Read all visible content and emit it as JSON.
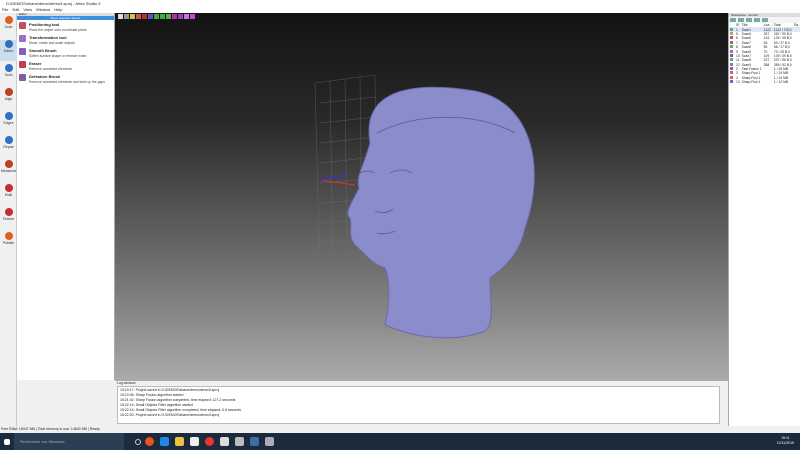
{
  "window": {
    "title": "D:\\DEMOS\\shane\\demo\\demo3.sproj - Artec Studio 9"
  },
  "menu": [
    "File",
    "Edit",
    "View",
    "Window",
    "Help"
  ],
  "left_toolbar": [
    {
      "label": "Scan",
      "color": "#e06020"
    },
    {
      "label": "Editor",
      "color": "#3070c0",
      "active": true
    },
    {
      "label": "Tools",
      "color": "#3070c0"
    },
    {
      "label": "Align",
      "color": "#c04020"
    },
    {
      "label": "Edges",
      "color": "#3070c0"
    },
    {
      "label": "Repair",
      "color": "#3070c0"
    },
    {
      "label": "Measures",
      "color": "#c04020"
    },
    {
      "label": "Multi",
      "color": "#c03030"
    },
    {
      "label": "Texture",
      "color": "#c03030"
    },
    {
      "label": "Publish",
      "color": "#e06020"
    }
  ],
  "tool_panel": {
    "header": "Editor",
    "banner": "Move selected objects",
    "tools": [
      {
        "title": "Positioning tool",
        "desc": "Place the object onto coordinate plane",
        "color": "#c05060"
      },
      {
        "title": "Transformation tool",
        "desc": "Move, rotate and scale objects",
        "color": "#a070c0"
      },
      {
        "title": "Smooth Brush",
        "desc": "Soften surface shape or remove noise",
        "color": "#8060c0"
      },
      {
        "title": "Eraser",
        "desc": "Remove unwanted elements",
        "color": "#c04050"
      },
      {
        "title": "Defeature Brush",
        "desc": "Remove unwanted elements and stick up the gaps",
        "color": "#8060a0"
      }
    ]
  },
  "log": {
    "header": "Log window",
    "lines": [
      "15:19:17: Project saved in D:\\DEMOS\\shane\\demo\\demo3.sproj",
      "15:19:35: Sharp Fusion algorithm started",
      "15:21:42: Sharp Fusion algorithm completed, time elapsed: 127.2 seconds",
      "15:22:14: Small Objects Filter algorithm started",
      "15:22:14: Small Objects Filter algorithm completed, time elapsed: 0.6 seconds",
      "15:22:20: Project saved in D:\\DEMOS\\shane\\demo\\demo3.sproj"
    ]
  },
  "workspace": {
    "header": "Workspace - demo3",
    "columns": [
      "ID",
      "Title",
      "Loa...",
      "Total",
      "Siz..."
    ],
    "rows": [
      {
        "id": "1",
        "title": "Scan1",
        "loaded": "1122",
        "total": "1122 / 0 B,0",
        "color": "#6a6"
      },
      {
        "id": "5",
        "title": "Scan5",
        "loaded": "267",
        "total": "267 / 90 B,0",
        "color": "#aa6"
      },
      {
        "id": "6",
        "title": "Scan6",
        "loaded": "134",
        "total": "134 / 45 B,0",
        "color": "#a66"
      },
      {
        "id": "7",
        "title": "Scan7",
        "loaded": "63",
        "total": "63 / 27 B,0",
        "color": "#a66"
      },
      {
        "id": "8",
        "title": "Scan8",
        "loaded": "56",
        "total": "56 / 17 B,0",
        "color": "#6a6"
      },
      {
        "id": "9",
        "title": "Scan9",
        "loaded": "70",
        "total": "70 / 25 B,0",
        "color": "#a6a"
      },
      {
        "id": "10",
        "title": "Scan7",
        "loaded": "109",
        "total": "109 / 39 B,0",
        "color": "#66a"
      },
      {
        "id": "11",
        "title": "Scan8",
        "loaded": "237",
        "total": "237 / 96 B,0",
        "color": "#6a6"
      },
      {
        "id": "12",
        "title": "Scan9",
        "loaded": "358",
        "total": "358 / 92 B,0",
        "color": "#a6a"
      },
      {
        "id": "2",
        "title": "Fast Fusion 1",
        "loaded": "",
        "total": "1 / 25 MB",
        "color": "#66c"
      },
      {
        "id": "3",
        "title": "Sharp Fusi 1",
        "loaded": "",
        "total": "1 / 24 MB",
        "color": "#c66"
      },
      {
        "id": "4",
        "title": "Sharp Fusi 1",
        "loaded": "",
        "total": "1 / 24 MB",
        "color": "#c66"
      },
      {
        "id": "13",
        "title": "Sharp Fusi 1",
        "loaded": "",
        "total": "1 / 12 MB",
        "color": "#66c"
      }
    ]
  },
  "status": {
    "text": "Free RAM: 19447 MB | Total memory in use: 14640 MB | Ready"
  },
  "taskbar": {
    "search_placeholder": "Rechercher sur Windows",
    "time": "15:11",
    "date": "12/11/2015"
  },
  "model": {
    "color": "#8a8ccc"
  }
}
